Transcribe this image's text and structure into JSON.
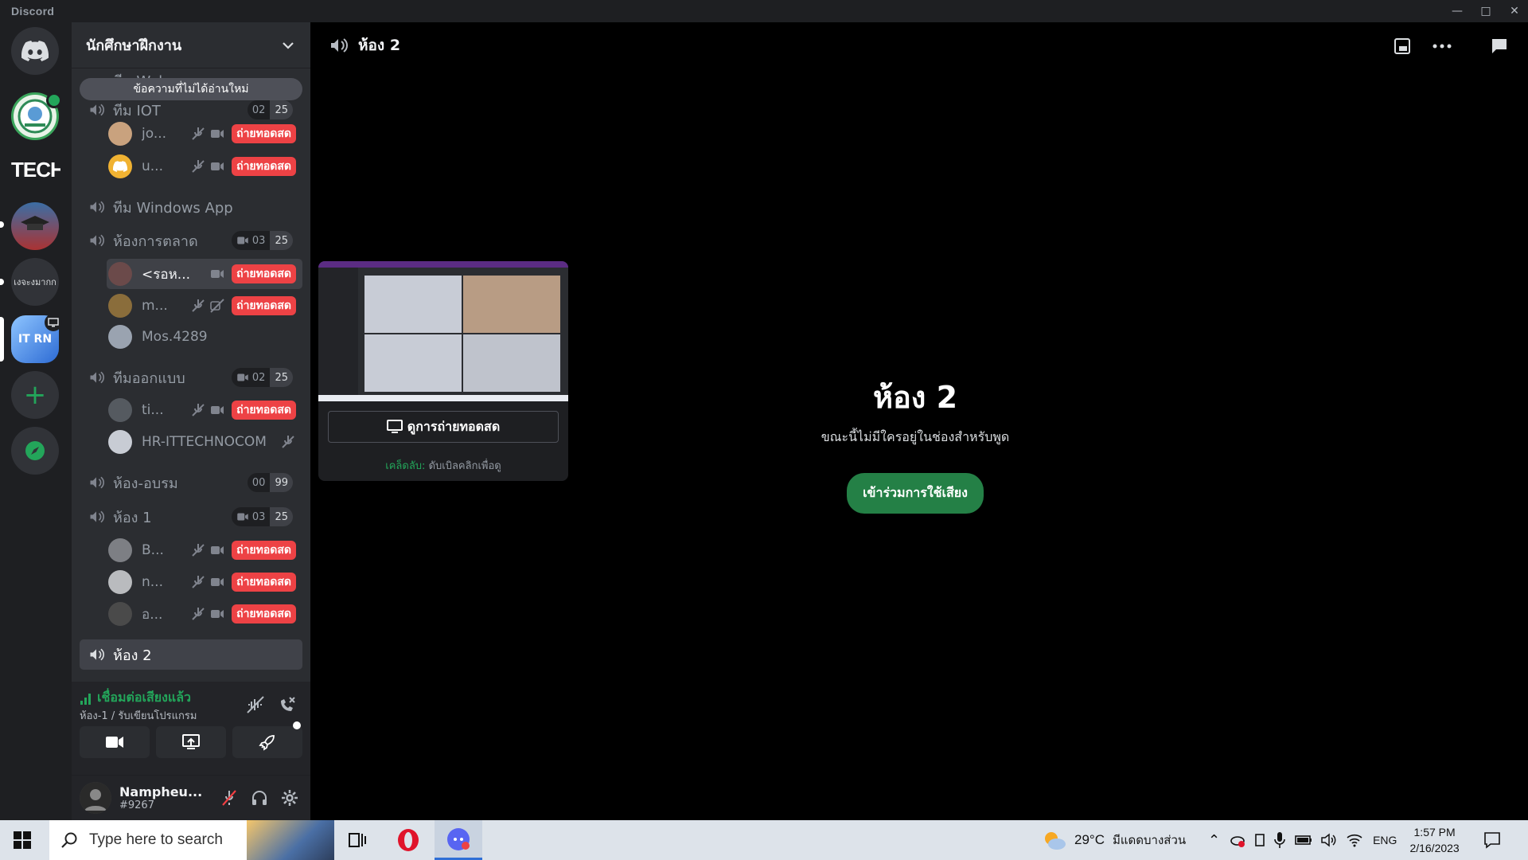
{
  "app": {
    "title": "Discord"
  },
  "servers": [
    {
      "name": "Discord Home"
    },
    {
      "name": "server-green-logo"
    },
    {
      "name": "TECHN"
    },
    {
      "name": "ปริญญา"
    },
    {
      "name": "เงจะงมากก"
    },
    {
      "name": "IT RN"
    }
  ],
  "sidebar": {
    "server_name": "นักศึกษาฝึกงาน",
    "unread_pill": "ข้อความที่ไม่ได้อ่านใหม่",
    "partial_channel_1": "ทีม Webapp",
    "partial_channel_2": {
      "name": "ทีม IOT",
      "count1": "02",
      "count2": "25"
    },
    "iot_users": [
      {
        "name": "jo...",
        "live": "ถ่ายทอดสด"
      },
      {
        "name": "u...",
        "live": "ถ่ายทอดสด"
      }
    ],
    "channel_windows": "ทีม Windows App",
    "channel_marketing": {
      "name": "ห้องการตลาด",
      "count1": "03",
      "count2": "25"
    },
    "marketing_users": [
      {
        "name": "<รอห...",
        "live": "ถ่ายทอดสด"
      },
      {
        "name": "m...",
        "live": "ถ่ายทอดสด"
      },
      {
        "name": "Mos.4289"
      }
    ],
    "channel_design": {
      "name": "ทีมออกแบบ",
      "count1": "02",
      "count2": "25"
    },
    "design_users": [
      {
        "name": "ti...",
        "live": "ถ่ายทอดสด"
      },
      {
        "name": "HR-ITTECHNOCOM"
      }
    ],
    "channel_training": {
      "name": "ห้อง-อบรม",
      "count1": "00",
      "count2": "99"
    },
    "channel_room1": {
      "name": "ห้อง 1",
      "count1": "03",
      "count2": "25"
    },
    "room1_users": [
      {
        "name": "B...",
        "live": "ถ่ายทอดสด"
      },
      {
        "name": "n...",
        "live": "ถ่ายทอดสด"
      },
      {
        "name": "อ...",
        "live": "ถ่ายทอดสด"
      }
    ],
    "channel_room2": "ห้อง 2"
  },
  "voice_panel": {
    "status": "เชื่อมต่อเสียงแล้ว",
    "location": "ห้อง-1 / รับเขียนโปรแกรม"
  },
  "user": {
    "name": "Nampheu...",
    "tag": "#9267"
  },
  "main": {
    "channel_title": "ห้อง 2",
    "watch_button": "ดูการถ่ายทอดสด",
    "tip_label": "เคล็ดลับ:",
    "tip_text": "ดับเบิลคลิกเพื่อดู",
    "empty_title": "ห้อง 2",
    "empty_subtitle": "ขณะนี้ไม่มีใครอยู่ในช่องสำหรับพูด",
    "join_button": "เข้าร่วมการใช้เสียง"
  },
  "taskbar": {
    "search_placeholder": "Type here to search",
    "weather_temp": "29°C",
    "weather_text": "มีแดดบางส่วน",
    "lang": "ENG",
    "time": "1:57 PM",
    "date": "2/16/2023"
  },
  "colors": {
    "accent_green": "#23a55a",
    "live_red": "#ed4245",
    "blurple": "#5865f2"
  }
}
